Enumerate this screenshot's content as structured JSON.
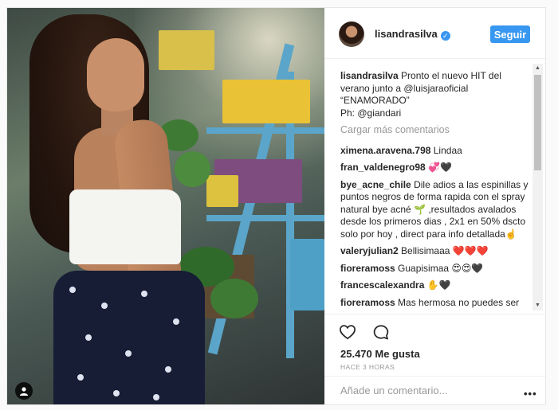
{
  "post": {
    "username": "lisandrasilva",
    "follow_label": "Seguir",
    "caption_user": "lisandrasilva",
    "caption_text": " Pronto el nuevo HIT del verano junto a @luisjaraoficial “ENAMORADO”",
    "caption_credit": "Ph: @giandari",
    "load_more": "Cargar más comentarios",
    "likes": "25.470 Me gusta",
    "time": "HACE 3 HORAS",
    "add_comment_placeholder": "Añade un comentario...",
    "more_label": "•••"
  },
  "comments": [
    {
      "user": "ximena.aravena.798",
      "text": " Lindaa"
    },
    {
      "user": "fran_valdenegro98",
      "text": " 💞🖤"
    },
    {
      "user": "bye_acne_chile",
      "text": " Dile adios a las espinillas y puntos negros de forma rapida con el spray natural bye acné 🌱 ,resultados avalados desde los primeros dias , 2x1 en 50% dscto solo por hoy , direct para info detallada☝️"
    },
    {
      "user": "valeryjulian2",
      "text": " Bellisimaaa ❤️❤️❤️"
    },
    {
      "user": "fioreramoss",
      "text": " Guapisimaa 😍😍🖤"
    },
    {
      "user": "francescalexandra",
      "text": " ✋🖤"
    },
    {
      "user": "fioreramoss",
      "text": " Mas hermosa no puedes ser"
    }
  ],
  "colors": {
    "follow_button": "#3897f0",
    "verified_badge": "#3897f0"
  },
  "icons": [
    "verified-badge-icon",
    "heart-icon",
    "comment-icon",
    "user-tag-icon",
    "more-options-icon"
  ]
}
